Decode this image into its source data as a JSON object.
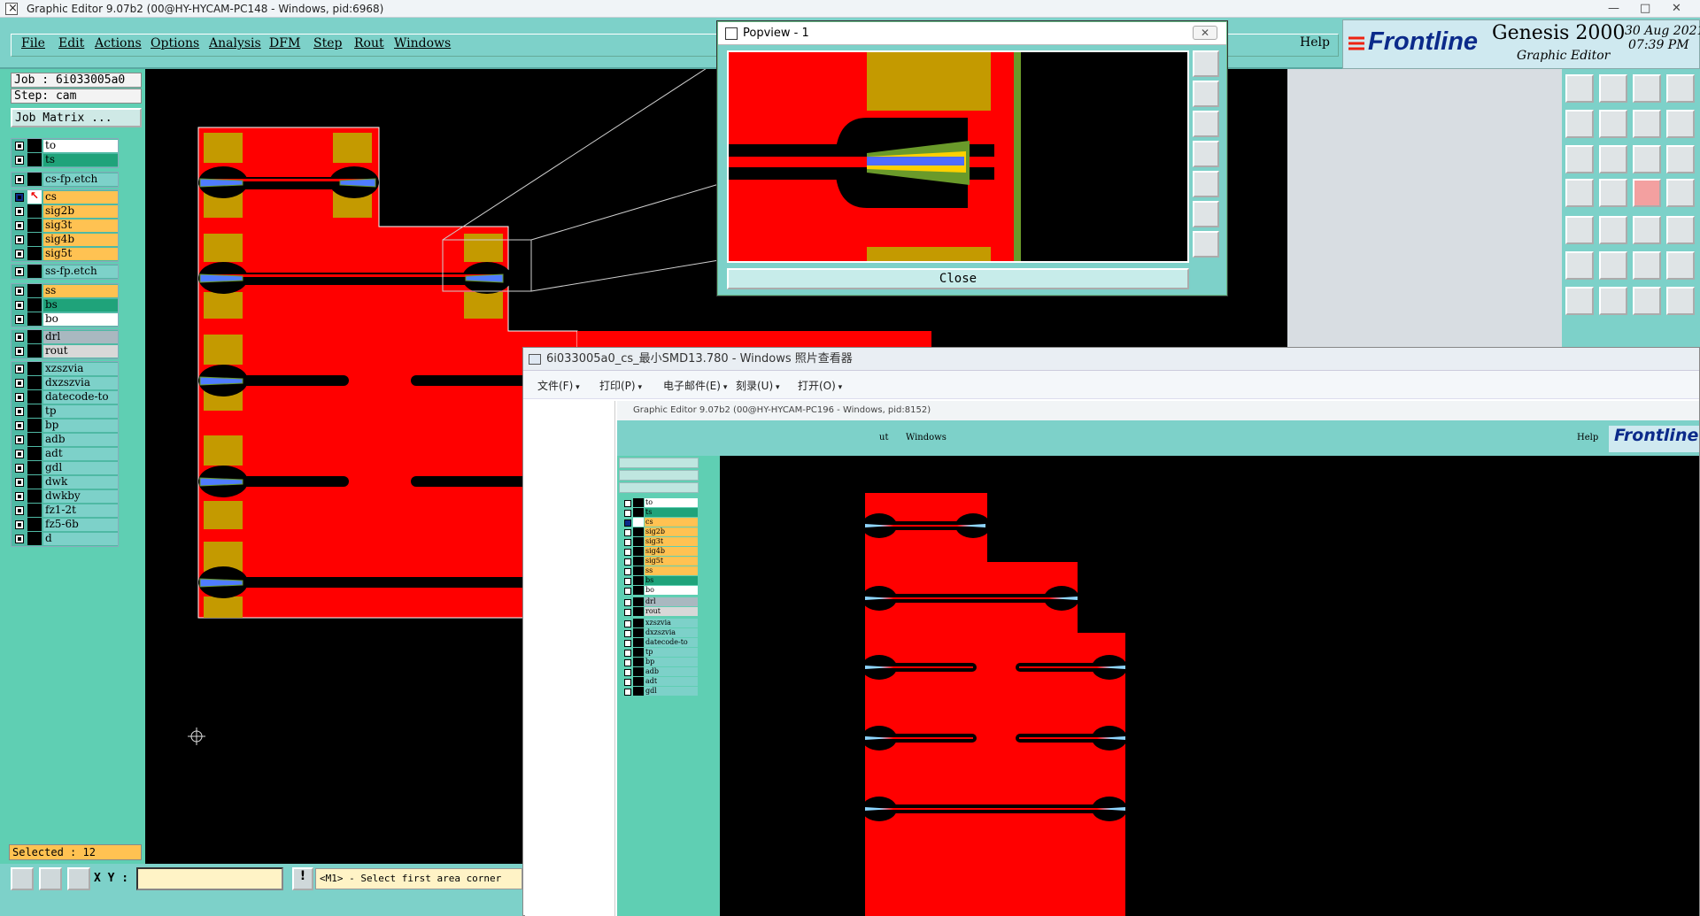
{
  "main_window": {
    "title": "Graphic Editor 9.07b2 (00@HY-HYCAM-PC148 - Windows, pid:6968)",
    "menu": [
      "File",
      "Edit",
      "Actions",
      "Options",
      "Analysis",
      "DFM",
      "Step",
      "Rout",
      "Windows"
    ],
    "help": "Help"
  },
  "brand": {
    "logo": "Frontline",
    "product": "Genesis 2000",
    "subtitle": "Graphic Editor",
    "date": "30 Aug 2021",
    "time": "07:39 PM"
  },
  "job_panel": {
    "job": "Job : 6i033005a0",
    "step": "Step: cam",
    "matrix_button": "Job Matrix ..."
  },
  "layers": {
    "group1": [
      {
        "name": "to",
        "color": "#ffffff"
      },
      {
        "name": "ts",
        "color": "#1fa37a"
      }
    ],
    "group2": [
      {
        "name": "cs-fp.etch",
        "color": "#7dd1c9"
      }
    ],
    "group3": [
      {
        "name": "cs",
        "color": "#ffc252"
      },
      {
        "name": "sig2b",
        "color": "#ffc252"
      },
      {
        "name": "sig3t",
        "color": "#ffc252"
      },
      {
        "name": "sig4b",
        "color": "#ffc252"
      },
      {
        "name": "sig5t",
        "color": "#ffc252"
      }
    ],
    "group4": [
      {
        "name": "ss-fp.etch",
        "color": "#7dd1c9"
      }
    ],
    "group5": [
      {
        "name": "ss",
        "color": "#ffc252"
      },
      {
        "name": "bs",
        "color": "#1fa37a"
      },
      {
        "name": "bo",
        "color": "#ffffff"
      }
    ],
    "group6": [
      {
        "name": "drl",
        "color": "#a9b8c0"
      },
      {
        "name": "rout",
        "color": "#d8d8d8"
      }
    ],
    "group7": [
      {
        "name": "xzszvia",
        "color": "#7dd1c9"
      },
      {
        "name": "dxzszvia",
        "color": "#7dd1c9"
      },
      {
        "name": "datecode-to",
        "color": "#7dd1c9"
      },
      {
        "name": "tp",
        "color": "#7dd1c9"
      },
      {
        "name": "bp",
        "color": "#7dd1c9"
      },
      {
        "name": "adb",
        "color": "#7dd1c9"
      },
      {
        "name": "adt",
        "color": "#7dd1c9"
      },
      {
        "name": "gdl",
        "color": "#7dd1c9"
      },
      {
        "name": "dwk",
        "color": "#7dd1c9"
      },
      {
        "name": "dwkby",
        "color": "#7dd1c9"
      },
      {
        "name": "fz1-2t",
        "color": "#7dd1c9"
      },
      {
        "name": "fz5-6b",
        "color": "#7dd1c9"
      },
      {
        "name": "d",
        "color": "#7dd1c9"
      }
    ]
  },
  "status": {
    "selected": "Selected : 12",
    "xy_label": "X Y :",
    "xy_value": "",
    "info_button": "!",
    "prompt": "<M1> - Select first area corner"
  },
  "popview": {
    "title": "Popview - 1",
    "close_x": "✕",
    "close_button": "Close"
  },
  "viewer": {
    "title": "6i033005a0_cs_最小SMD13.780 - Windows 照片查看器",
    "menu": [
      "文件(F)",
      "打印(P)",
      "电子邮件(E)",
      "刻录(U)",
      "打开(O)"
    ],
    "inner_title": "Graphic Editor 9.07b2 (00@HY-HYCAM-PC196 - Windows, pid:8152)",
    "inner_menu_partial": "ut",
    "inner_windows": "Windows",
    "inner_help": "Help",
    "inner_logo": "Frontline",
    "inner_layers": [
      "to",
      "ts",
      "cs",
      "sig2b",
      "sig3t",
      "sig4b",
      "sig5t",
      "ss",
      "bs",
      "bo",
      "drl",
      "rout",
      "xzszvia",
      "dxzszvia",
      "datecode-to",
      "tp",
      "bp",
      "adb",
      "adt",
      "gdl"
    ]
  },
  "colors": {
    "panel": "#7dd1c9",
    "copper": "#ff0000",
    "pad": "#c49a00",
    "highlight": "#ffc252",
    "canvas": "#000000"
  }
}
